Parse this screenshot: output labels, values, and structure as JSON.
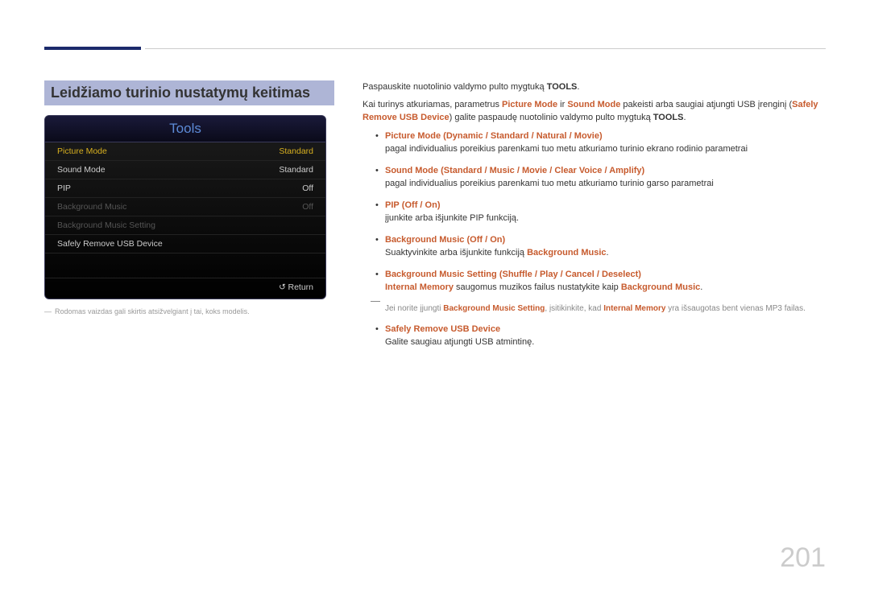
{
  "section_title": "Leidžiamo turinio nustatymų keitimas",
  "tools_panel": {
    "title": "Tools",
    "rows": [
      {
        "label": "Picture Mode",
        "value": "Standard",
        "state": "selected"
      },
      {
        "label": "Sound Mode",
        "value": "Standard",
        "state": ""
      },
      {
        "label": "PIP",
        "value": "Off",
        "state": ""
      },
      {
        "label": "Background Music",
        "value": "Off",
        "state": "dim"
      },
      {
        "label": "Background Music Setting",
        "value": "",
        "state": "dim"
      },
      {
        "label": "Safely Remove USB Device",
        "value": "",
        "state": ""
      }
    ],
    "return_label": "Return"
  },
  "footnote_dash": "―",
  "footnote_text": "Rodomas vaizdas gali skirtis atsižvelgiant į tai, koks modelis.",
  "body": {
    "p1_a": "Paspauskite nuotolinio valdymo pulto mygtuką ",
    "p1_b": "TOOLS",
    "p1_c": ".",
    "p2_a": "Kai turinys atkuriamas, parametrus ",
    "p2_b": "Picture Mode",
    "p2_c": " ir ",
    "p2_d": "Sound Mode",
    "p2_e": " pakeisti arba saugiai atjungti USB įrenginį (",
    "p2_f": "Safely Remove USB Device",
    "p2_g": ") galite paspaudę nuotolinio valdymo pulto mygtuką ",
    "p2_h": "TOOLS",
    "p2_i": "."
  },
  "items": {
    "pm": {
      "name": "Picture Mode",
      "opts": [
        "Dynamic",
        "Standard",
        "Natural",
        "Movie"
      ],
      "desc": "pagal individualius poreikius parenkami tuo metu atkuriamo turinio ekrano rodinio parametrai"
    },
    "sm": {
      "name": "Sound Mode",
      "opts": [
        "Standard",
        "Music",
        "Movie",
        "Clear Voice",
        "Amplify"
      ],
      "desc": "pagal individualius poreikius parenkami tuo metu atkuriamo turinio garso parametrai"
    },
    "pip": {
      "name": "PIP",
      "opts": [
        "Off",
        "On"
      ],
      "desc": "įjunkite arba išjunkite PIP funkciją."
    },
    "bgm": {
      "name": "Background Music",
      "opts": [
        "Off",
        "On"
      ],
      "desc_a": "Suaktyvinkite arba išjunkite funkciją ",
      "desc_b": "Background Music",
      "desc_c": "."
    },
    "bgms": {
      "name": "Background Music Setting",
      "opts": [
        "Shuffle",
        "Play",
        "Cancel",
        "Deselect"
      ],
      "desc_a": "Internal Memory",
      "desc_b": " saugomus muzikos failus nustatykite kaip ",
      "desc_c": "Background Music",
      "desc_d": "."
    },
    "note": {
      "a": "Jei norite įjungti ",
      "b": "Background Music Setting",
      "c": ", įsitikinkite, kad ",
      "d": "Internal Memory",
      "e": " yra išsaugotas bent vienas MP3 failas."
    },
    "usb": {
      "name": "Safely Remove USB Device",
      "desc": "Galite saugiau atjungti USB atmintinę."
    }
  },
  "page_number": "201"
}
